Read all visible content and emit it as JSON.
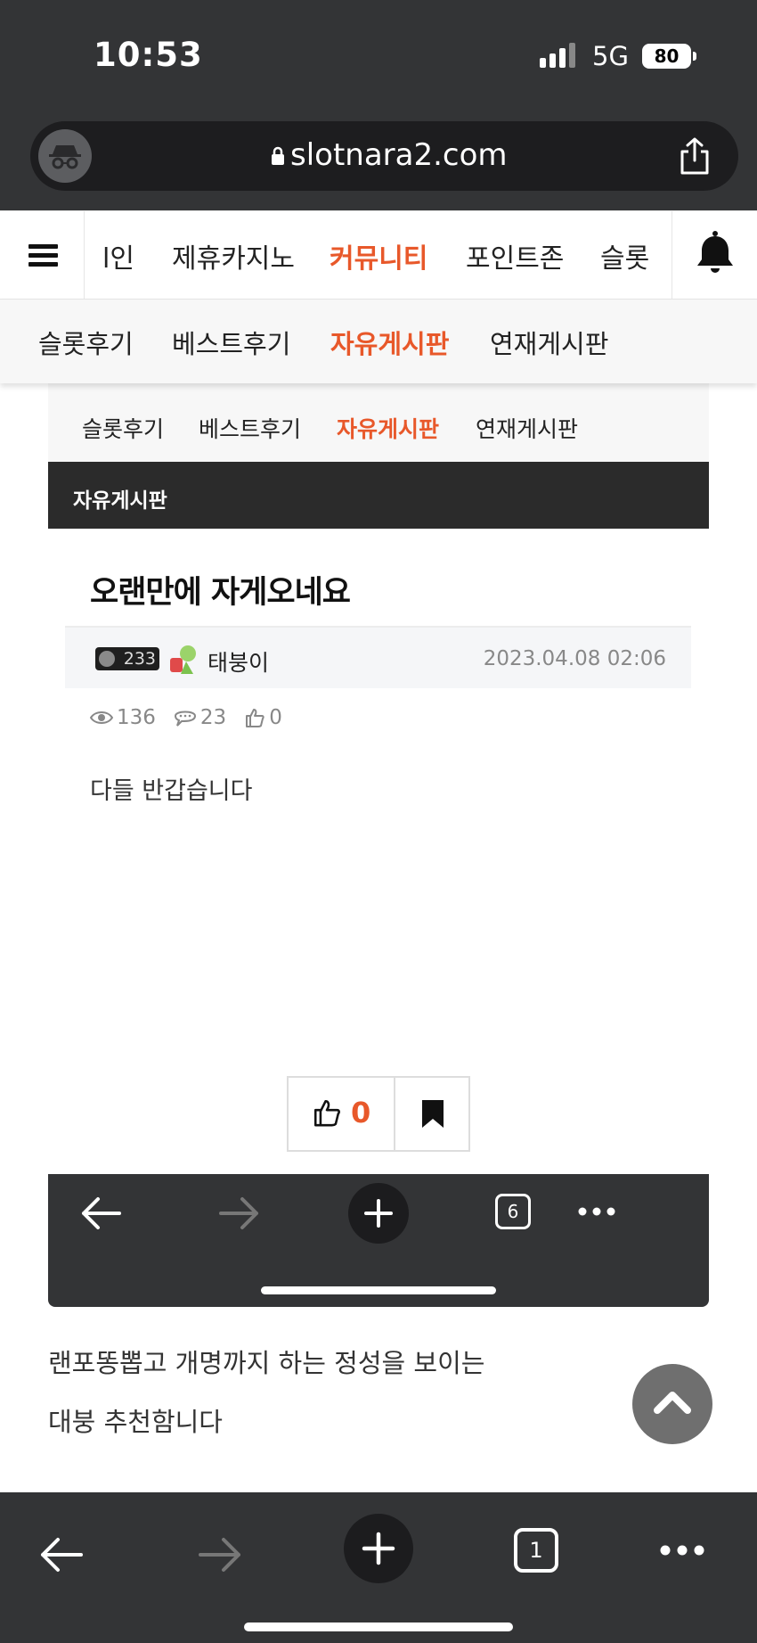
{
  "status": {
    "time": "10:53",
    "network": "5G",
    "battery": "80"
  },
  "browser": {
    "url": "slotnara2.com",
    "tab_count": "1"
  },
  "nav": {
    "items": [
      "l인",
      "제휴카지노",
      "커뮤니티",
      "포인트존",
      "슬롯"
    ],
    "active": "커뮤니티"
  },
  "subnav": {
    "items": [
      "슬롯후기",
      "베스트후기",
      "자유게시판",
      "연재게시판"
    ],
    "active": "자유게시판"
  },
  "inner": {
    "subnav": [
      "슬롯후기",
      "베스트후기",
      "자유게시판",
      "연재게시판"
    ],
    "board_title": "자유게시판",
    "post": {
      "title": "오랜만에 자게오네요",
      "level": "233",
      "author": "태붕이",
      "date": "2023.04.08 02:06",
      "views": "136",
      "comments": "23",
      "likes": "0",
      "body": "다들 반갑습니다",
      "vote_count": "0"
    },
    "tab_count": "6"
  },
  "comment": {
    "line1": "랜포똥뽑고 개명까지 하는 정성을 보이는",
    "line2": "대붕 추천함니다"
  },
  "colors": {
    "accent": "#e8582a",
    "dark": "#333436"
  }
}
